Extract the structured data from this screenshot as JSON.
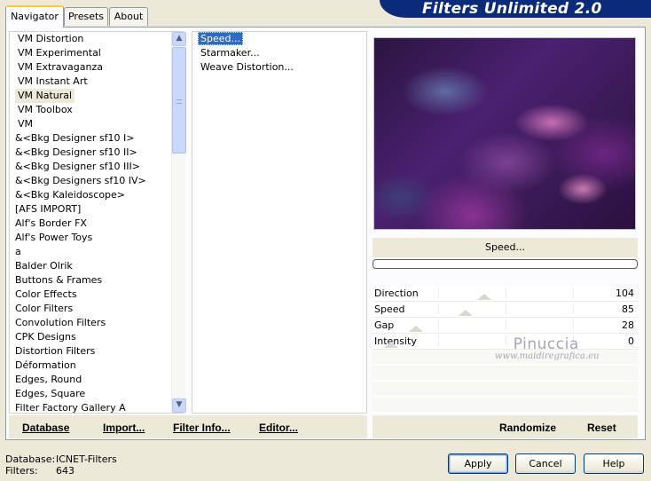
{
  "header": {
    "title": "Filters Unlimited 2.0"
  },
  "tabs": [
    {
      "label": "Navigator"
    },
    {
      "label": "Presets"
    },
    {
      "label": "About"
    }
  ],
  "categories": [
    "VM Distortion",
    "VM Experimental",
    "VM Extravaganza",
    "VM Instant Art",
    "VM Natural",
    "VM Toolbox",
    "VM",
    "&<Bkg Designer sf10 I>",
    "&<Bkg Designer sf10 II>",
    "&<Bkg Designer sf10 III>",
    "&<Bkg Designers sf10 IV>",
    "&<Bkg Kaleidoscope>",
    "[AFS IMPORT]",
    "Alf's Border FX",
    "Alf's Power Toys",
    "a",
    "Balder Olrik",
    "Buttons & Frames",
    "Color Effects",
    "Color Filters",
    "Convolution Filters",
    "CPK Designs",
    "Distortion Filters",
    "Déformation",
    "Edges, Round",
    "Edges, Square",
    "Filter Factory Gallery A"
  ],
  "filters": [
    "Speed...",
    "Starmaker...",
    "Weave Distortion..."
  ],
  "preview": {
    "filter_name": "Speed..."
  },
  "parameters": [
    {
      "name": "Direction",
      "value": "104",
      "level": 0.41
    },
    {
      "name": "Speed",
      "value": "85",
      "level": 0.33
    },
    {
      "name": "Gap",
      "value": "28",
      "level": 0.11
    },
    {
      "name": "Intensity",
      "value": "0",
      "level": 0.0
    }
  ],
  "watermark": {
    "name": "Pinuccia",
    "url": "www.maidiregrafica.eu"
  },
  "commands": {
    "database": "Database",
    "import": "Import...",
    "filter_info": "Filter Info...",
    "editor": "Editor...",
    "randomize": "Randomize",
    "reset": "Reset"
  },
  "footer": {
    "database_label": "Database:",
    "database_value": "ICNET-Filters",
    "filters_label": "Filters:",
    "filters_value": "643"
  },
  "buttons": {
    "apply": "Apply",
    "cancel": "Cancel",
    "help": "Help"
  }
}
